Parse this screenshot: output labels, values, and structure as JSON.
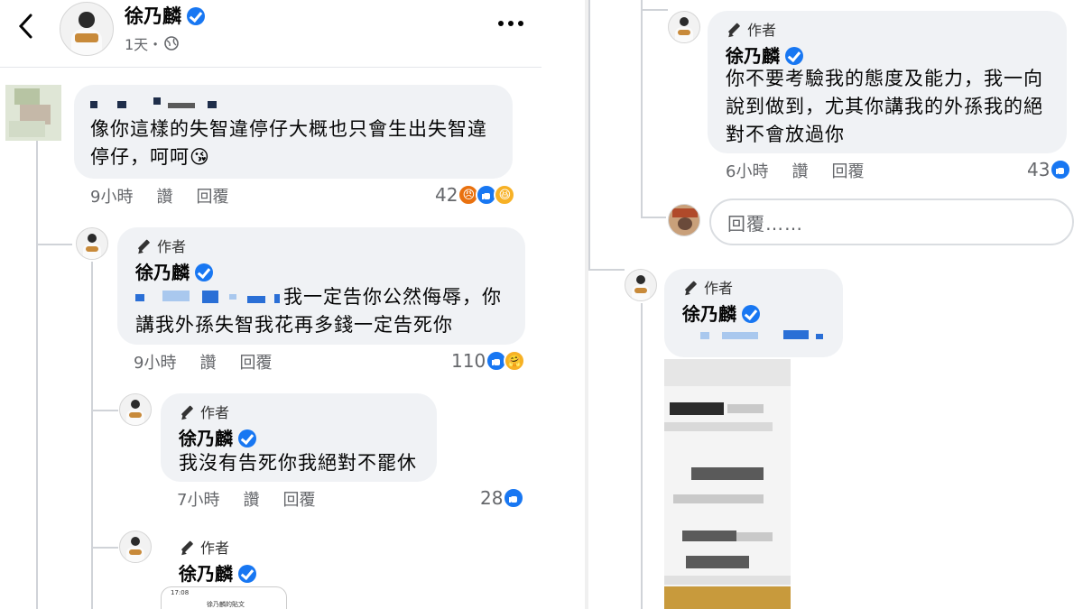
{
  "header": {
    "author_name": "徐乃麟",
    "timestamp": "1天・",
    "back_icon": "chevron-left-icon",
    "more_icon": "more-horizontal-icon",
    "globe_icon": "globe-icon"
  },
  "colors": {
    "like_blue": "#1877f2",
    "bubble_bg": "#f0f2f5",
    "meta_gray": "#65676b"
  },
  "left_comments": [
    {
      "text": "像你這樣的失智違停仔大概也只會生出失智違停仔，呵呵😘",
      "time": "9小時",
      "like_label": "讚",
      "reply_label": "回覆",
      "reaction_count": "42",
      "reactions": [
        "angry",
        "like",
        "haha"
      ]
    },
    {
      "author_badge": "作者",
      "name": "徐乃麟",
      "text": "我一定告你公然侮辱，你講我外孫失智我花再多錢一定告死你",
      "time": "9小時",
      "like_label": "讚",
      "reply_label": "回覆",
      "reaction_count": "110",
      "reactions": [
        "like",
        "care"
      ]
    },
    {
      "author_badge": "作者",
      "name": "徐乃麟",
      "text": "我沒有告死你我絕對不罷休",
      "time": "7小時",
      "like_label": "讚",
      "reply_label": "回覆",
      "reaction_count": "28",
      "reactions": [
        "like"
      ]
    },
    {
      "author_badge": "作者",
      "name": "徐乃麟",
      "screenshot_header": "徐乃麟的貼文",
      "screenshot_time": "17:08"
    }
  ],
  "right_comments": [
    {
      "author_badge": "作者",
      "name": "徐乃麟",
      "text": "你不要考驗我的態度及能力，我一向說到做到，尤其你講我的外孫我的絕對不會放過你",
      "time": "6小時",
      "like_label": "讚",
      "reply_label": "回覆",
      "reaction_count": "43",
      "reactions": [
        "like"
      ]
    },
    {
      "reply_placeholder": "回覆……"
    },
    {
      "author_badge": "作者",
      "name": "徐乃麟"
    }
  ]
}
